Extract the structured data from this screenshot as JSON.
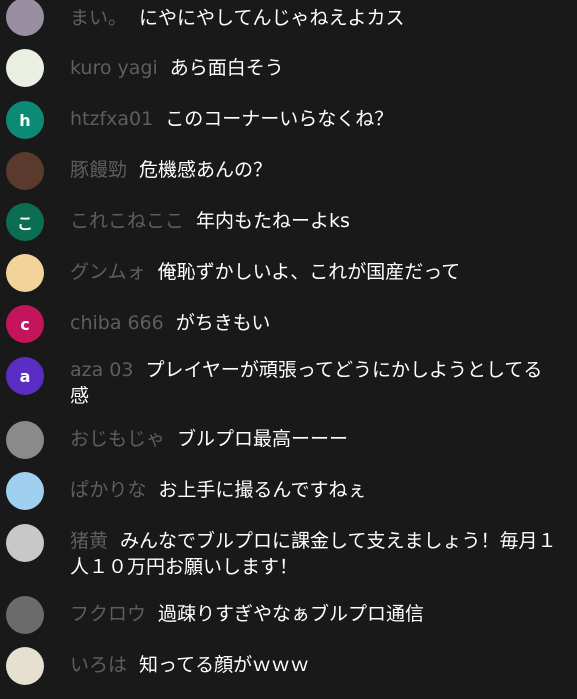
{
  "messages": [
    {
      "author": "まい。",
      "text": "にやにやしてんじゃねえよカス",
      "avatar": {
        "letter": "",
        "color": "#9a8ea2"
      }
    },
    {
      "author": "kuro yagi",
      "text": "あら面白そう",
      "avatar": {
        "letter": "",
        "color": "#e9f0e2"
      }
    },
    {
      "author": "htzfxa01",
      "text": "このコーナーいらなくね？",
      "avatar": {
        "letter": "h",
        "color": "#0b8b76"
      }
    },
    {
      "author": "豚饅勁",
      "text": "危機感あんの？",
      "avatar": {
        "letter": "",
        "color": "#5a3a2c"
      }
    },
    {
      "author": "これこねここ",
      "text": "年内もたねーよks",
      "avatar": {
        "letter": "こ",
        "color": "#0b6e52"
      }
    },
    {
      "author": "グンムォ",
      "text": "俺恥ずかしいよ、これが国産だって",
      "avatar": {
        "letter": "",
        "color": "#f2d39a"
      }
    },
    {
      "author": "chiba 666",
      "text": "がちきもい",
      "avatar": {
        "letter": "c",
        "color": "#c4155c"
      }
    },
    {
      "author": "aza 03",
      "text": "プレイヤーが頑張ってどうにかしようとしてる感",
      "avatar": {
        "letter": "a",
        "color": "#5a2dc4"
      }
    },
    {
      "author": "おじもじゃ",
      "text": "ブルプロ最高ーーー",
      "avatar": {
        "letter": "",
        "color": "#8a8a8a"
      }
    },
    {
      "author": "ぱかりな",
      "text": "お上手に撮るんですねぇ",
      "avatar": {
        "letter": "",
        "color": "#9fd0f2"
      }
    },
    {
      "author": "猪黄",
      "text": "みんなでブルプロに課金して支えましょう！毎月１人１０万円お願いします！",
      "avatar": {
        "letter": "",
        "color": "#c8c8c8"
      }
    },
    {
      "author": "フクロウ",
      "text": "過疎りすぎやなぁブルプロ通信",
      "avatar": {
        "letter": "",
        "color": "#6b6b6b"
      }
    },
    {
      "author": "いろは",
      "text": "知ってる顔がｗｗｗ",
      "avatar": {
        "letter": "",
        "color": "#e6e0d0"
      }
    }
  ]
}
